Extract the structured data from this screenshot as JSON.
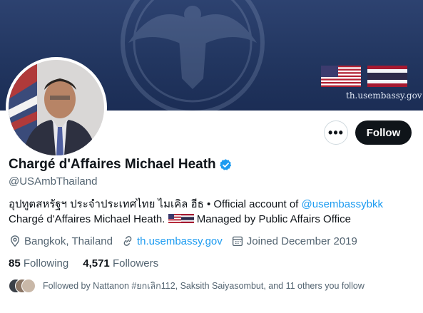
{
  "banner": {
    "url_text": "th.usembassy.gov",
    "flags": [
      "us-flag-icon",
      "thai-flag-icon"
    ]
  },
  "actions": {
    "more_label": "•••",
    "follow_label": "Follow"
  },
  "profile": {
    "name": "Chargé d'Affaires Michael Heath",
    "handle": "@USAmbThailand",
    "bio_prefix": "อุปทูตสหรัฐฯ ประจำประเทศไทย ไมเคิล ฮีธ • Official account of ",
    "bio_mention": "@usembassybkk",
    "bio_middle": " Chargé d'Affaires Michael Heath. ",
    "bio_suffix": " Managed by Public Affairs Office",
    "location": "Bangkok, Thailand",
    "website": "th.usembassy.gov",
    "joined": "Joined December 2019"
  },
  "stats": {
    "following_count": "85",
    "following_label": "Following",
    "followers_count": "4,571",
    "followers_label": "Followers"
  },
  "followed_by": "Followed by Nattanon #ยกเลิก112, Saksith Saiyasombut, and 11 others you follow",
  "colors": {
    "link": "#1d9bf0",
    "verified": "#1d9bf0",
    "banner": "#223660",
    "text_secondary": "#536471"
  }
}
